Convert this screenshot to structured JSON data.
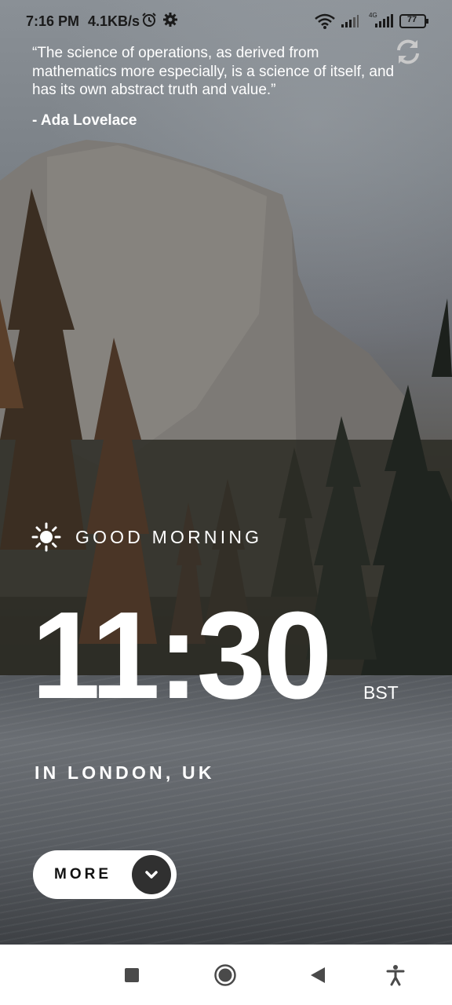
{
  "status_bar": {
    "time": "7:16 PM",
    "net_speed": "4.1KB/s",
    "network_label": "4G",
    "battery": "77",
    "icons": [
      "alarm-icon",
      "settings-icon",
      "wifi-icon",
      "signal-icon",
      "battery-icon"
    ]
  },
  "quote": {
    "text": "“The science of operations, as derived from mathematics more especially, is a science of itself, and has its own abstract truth and value.”",
    "author": "- Ada Lovelace",
    "refresh_icon": "refresh-icon"
  },
  "clock": {
    "greeting": "GOOD MORNING",
    "greeting_icon": "sun-icon",
    "time": "11:30",
    "timezone": "BST",
    "location": "IN LONDON, UK"
  },
  "more_button": {
    "label": "MORE",
    "icon": "chevron-down-icon"
  },
  "nav_bar": {
    "buttons": [
      "recents-icon",
      "home-icon",
      "back-icon",
      "accessibility-icon"
    ]
  },
  "colors": {
    "text": "#ffffff",
    "button_bg": "#ffffff",
    "button_circle": "#303030",
    "nav_icon": "#4a4a4a"
  }
}
